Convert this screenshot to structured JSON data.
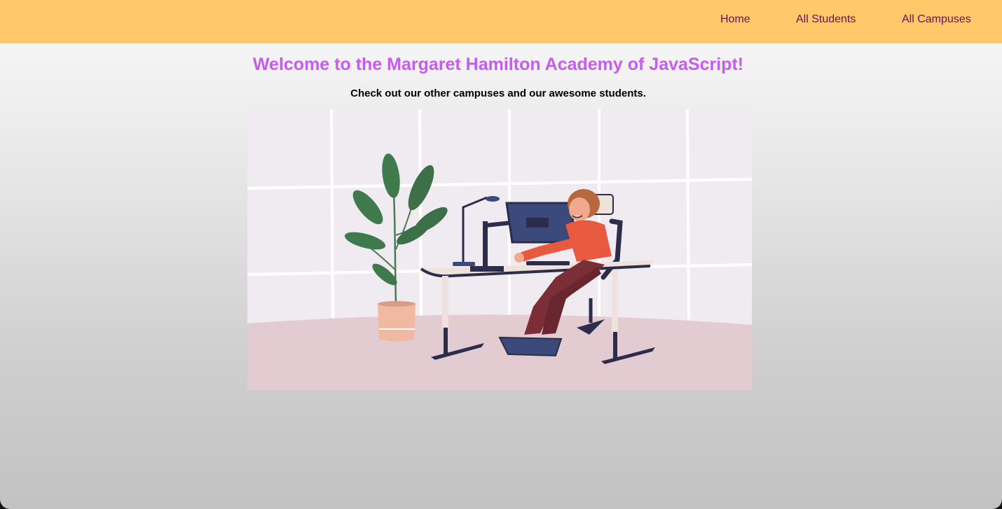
{
  "nav": {
    "home": "Home",
    "students": "All Students",
    "campuses": "All Campuses"
  },
  "main": {
    "title": "Welcome to the Margaret Hamilton Academy of JavaScript!",
    "subtitle": "Check out our other campuses and our awesome students."
  },
  "colors": {
    "navbar": "#ffc96b",
    "nav_link": "#6a0f5a",
    "title": "#c75bf0"
  },
  "illustration": {
    "subject": "woman-working-at-desk-illustration"
  }
}
